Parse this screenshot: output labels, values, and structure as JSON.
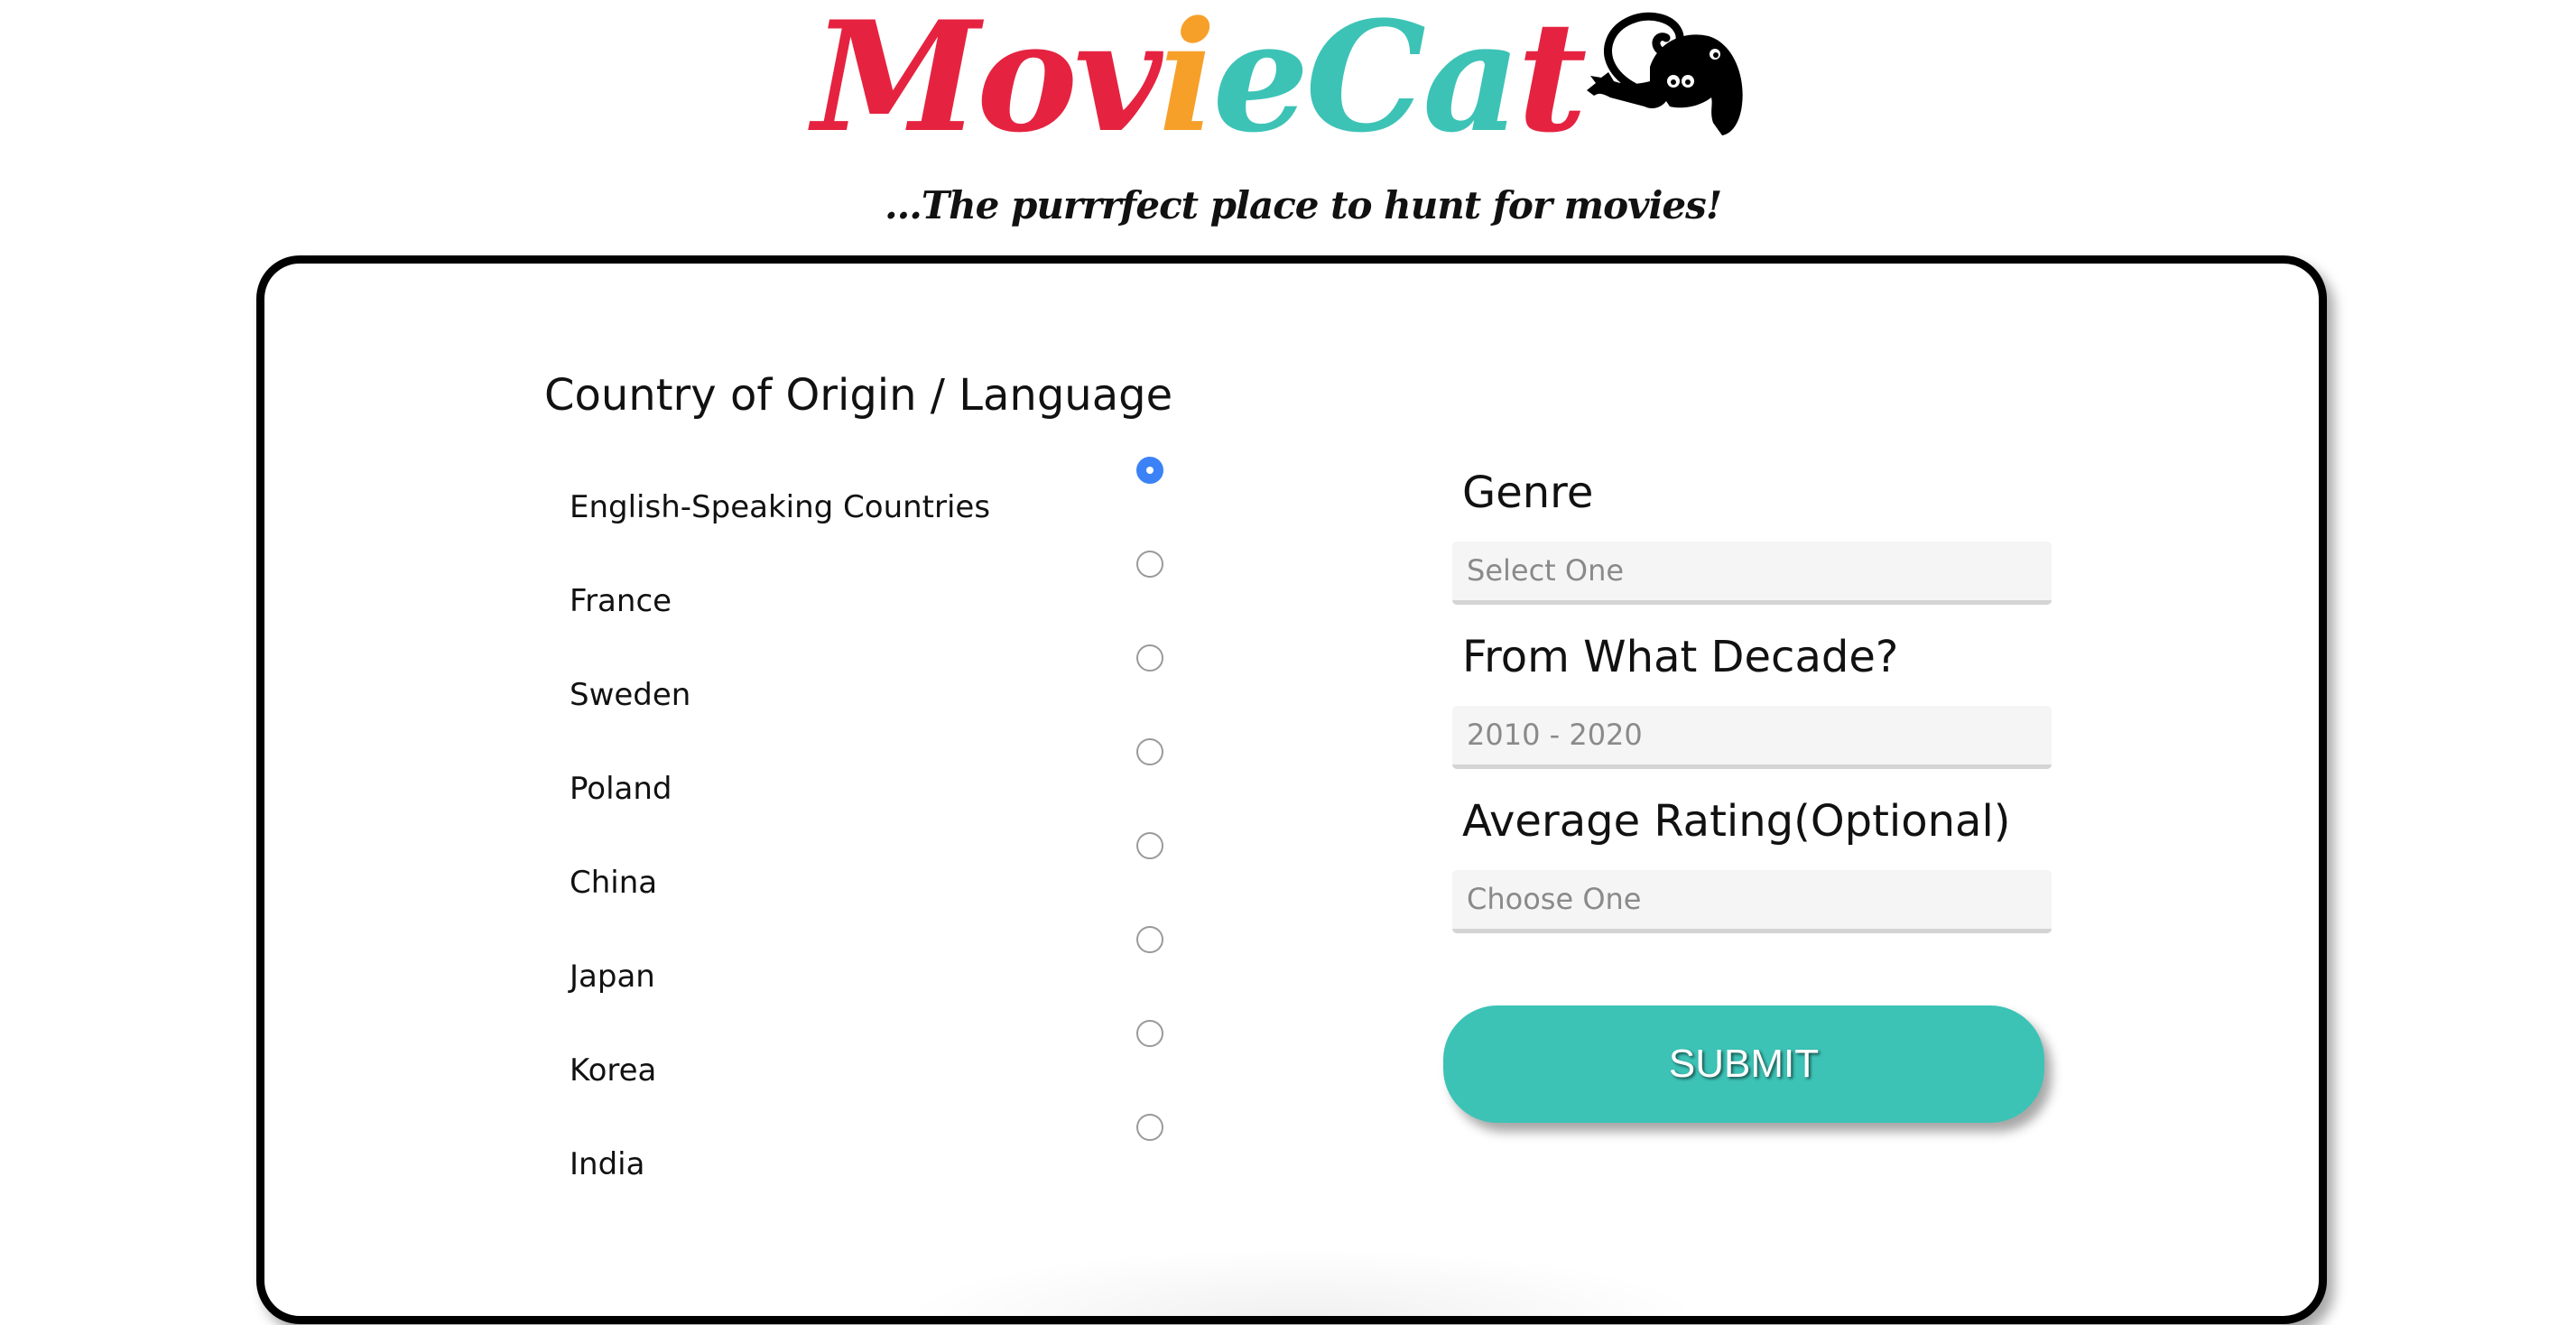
{
  "header": {
    "logo_parts": [
      "Mov",
      "i",
      "e",
      " Ca",
      "t"
    ],
    "logo_colors": [
      "#e52340",
      "#f6a02a",
      "#3cc3b6",
      "#3cc3b6",
      "#e52340"
    ],
    "logo_text": "Movie Cat",
    "tagline": "...The purrrfect place to hunt for movies!"
  },
  "country": {
    "heading": "Country of Origin / Language",
    "options": [
      {
        "label": "English-Speaking Countries",
        "checked": true
      },
      {
        "label": "France",
        "checked": false
      },
      {
        "label": "Sweden",
        "checked": false
      },
      {
        "label": "Poland",
        "checked": false
      },
      {
        "label": "China",
        "checked": false
      },
      {
        "label": "Japan",
        "checked": false
      },
      {
        "label": "Korea",
        "checked": false
      },
      {
        "label": "India",
        "checked": false
      }
    ]
  },
  "genre": {
    "heading": "Genre",
    "value": "Select One"
  },
  "decade": {
    "heading": "From What Decade?",
    "value": "2010 - 2020"
  },
  "rating": {
    "heading": "Average Rating(Optional)",
    "value": "Choose One"
  },
  "submit": {
    "label": "SUBMIT"
  },
  "colors": {
    "accent": "#3cc3b6",
    "red": "#e52340",
    "orange": "#f6a02a",
    "radio_checked": "#3b82f6"
  },
  "icons": {
    "logo_icon": "cat-icon"
  }
}
